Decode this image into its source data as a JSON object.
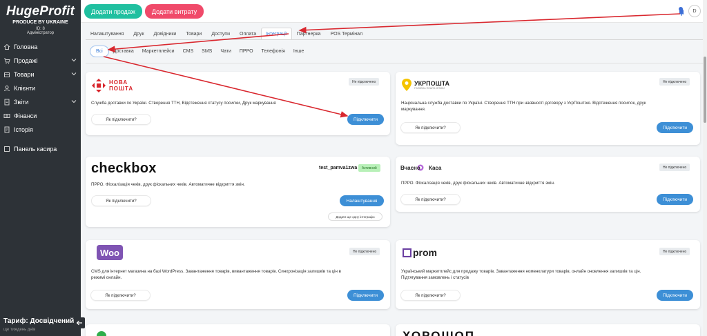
{
  "sidebar": {
    "logo": "HugeProfit",
    "logo_sub": "PRODUCE BY UKRAINE",
    "user_id": "ID: 8",
    "role": "Адміністратор",
    "items": [
      {
        "label": "Головна",
        "icon": "home-icon",
        "chevron": false
      },
      {
        "label": "Продажі",
        "icon": "cart-icon",
        "chevron": true
      },
      {
        "label": "Товари",
        "icon": "box-icon",
        "chevron": true
      },
      {
        "label": "Клієнти",
        "icon": "user-icon",
        "chevron": false
      },
      {
        "label": "Звіти",
        "icon": "report-icon",
        "chevron": true
      },
      {
        "label": "Фінанси",
        "icon": "finance-icon",
        "chevron": false
      },
      {
        "label": "Історія",
        "icon": "history-icon",
        "chevron": false
      }
    ],
    "cashier_panel": "Панель касира",
    "tariff": "Тариф: Досвідчений",
    "tariff_sub": "ще тиждень днів"
  },
  "topbar": {
    "add_sale": "Додати продаж",
    "add_expense": "Додати витрату",
    "notification_count": "5",
    "avatar_letter": "D"
  },
  "tabs": [
    "Налаштування",
    "Друк",
    "Довідники",
    "Товари",
    "Доступи",
    "Оплата",
    "Інтеграції",
    "Партнерка",
    "POS Термінал"
  ],
  "active_tab": "Інтеграції",
  "subtabs": [
    "Всі",
    "Доставка",
    "Маркетплейси",
    "CMS",
    "SMS",
    "Чати",
    "ПРРО",
    "Телефонія",
    "Інше"
  ],
  "active_subtab": "Всі",
  "cards": {
    "novaposhta": {
      "logo_line1": "НОВА",
      "logo_line2": "ПОШТА",
      "status": "Не підключено",
      "desc": "Служба доставки по Україні. Створення ТТН, Відстеження статусу посилки, Друк маркування",
      "how": "Як підключити?",
      "action": "Підключити"
    },
    "ukrposhta": {
      "logo": "УКРПОШТА",
      "logo_sub": "ГОЛОВНА ПОШТА КРАЇНИ",
      "status": "Не підключено",
      "desc": "Національна служба доставки по Україні. Створення ТТН при наявності договору з УкрПоштою. Відстеження посилок, друк маркування.",
      "how": "Як підключити?",
      "action": "Підключити"
    },
    "checkbox": {
      "logo": "checkbox",
      "account": "test_pamva1zwa",
      "status": "Активний",
      "desc": "ПРРО. Фіскалізація чеків, друк фіскальних чеків. Автоматичне відкриття змін.",
      "how": "Як підключити?",
      "action": "Налаштування",
      "add": "Додати ще одну інтеграцію"
    },
    "vchasno": {
      "logo": "Вчасно Каса",
      "status": "Не підключено",
      "desc": "ПРРО. Фіскалізація чеків, друк фіскальних чеків. Автоматичне відкриття змін.",
      "how": "Як підключити?",
      "action": "Підключити"
    },
    "woo": {
      "logo": "Woo",
      "status": "Не підключено",
      "desc": "CMS для інтернет магазина на базі WordPress. Завантаження товарів, вивантаження товарів. Синхронізація залишків та цін в режимі онлайн.",
      "how": "Як підключити?",
      "action": "Підключити"
    },
    "prom": {
      "logo": "prom",
      "status": "Не підключено",
      "desc": "Український маркетплейс для продажу товарів. Завантаження номенклатури товарів, онлайн оновлення залишків та цін. Підтягування замовлень і статусів",
      "how": "Як підключити?",
      "action": "Підключити"
    },
    "partial_right_logo": "ХОРОШОП"
  },
  "colors": {
    "sidebar_bg": "#2d3237",
    "sale_btn": "#20c0a0",
    "expense_btn": "#f04a6a",
    "primary": "#3d8fd6",
    "annotation_arrow": "#d9282f"
  }
}
